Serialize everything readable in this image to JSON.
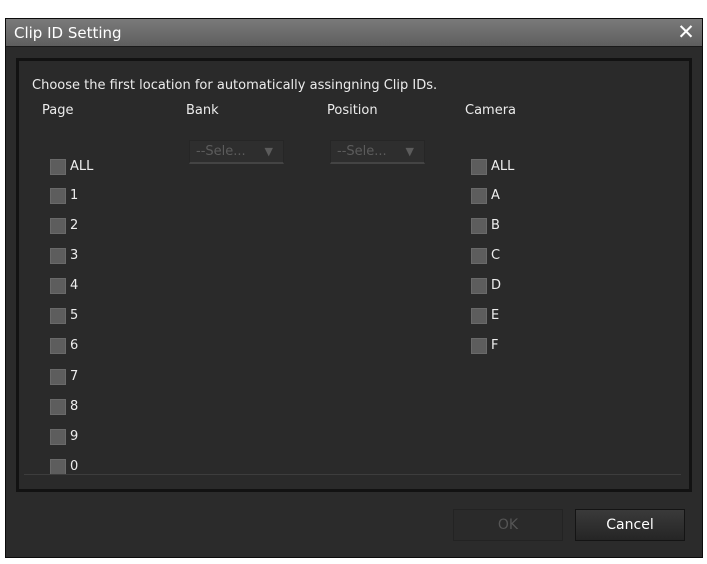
{
  "dialog": {
    "title": "Clip ID Setting",
    "close_glyph": "✕",
    "instruction": "Choose the first location for automatically assingning Clip IDs.",
    "columns": {
      "page": "Page",
      "bank": "Bank",
      "position": "Position",
      "camera": "Camera"
    },
    "page_options": [
      "ALL",
      "1",
      "2",
      "3",
      "4",
      "5",
      "6",
      "7",
      "8",
      "9",
      "0"
    ],
    "camera_options": [
      "ALL",
      "A",
      "B",
      "C",
      "D",
      "E",
      "F"
    ],
    "bank_select": {
      "value": "--Sele...",
      "arrow": "▼"
    },
    "position_select": {
      "value": "--Sele...",
      "arrow": "▼"
    },
    "buttons": {
      "ok": "OK",
      "cancel": "Cancel"
    }
  },
  "colors": {
    "dialog_bg": "#2b2b2b",
    "titlebar": "#6e6e6e",
    "checkbox": "#5d5d5d",
    "text": "#ececec",
    "disabled_text": "#555555"
  }
}
